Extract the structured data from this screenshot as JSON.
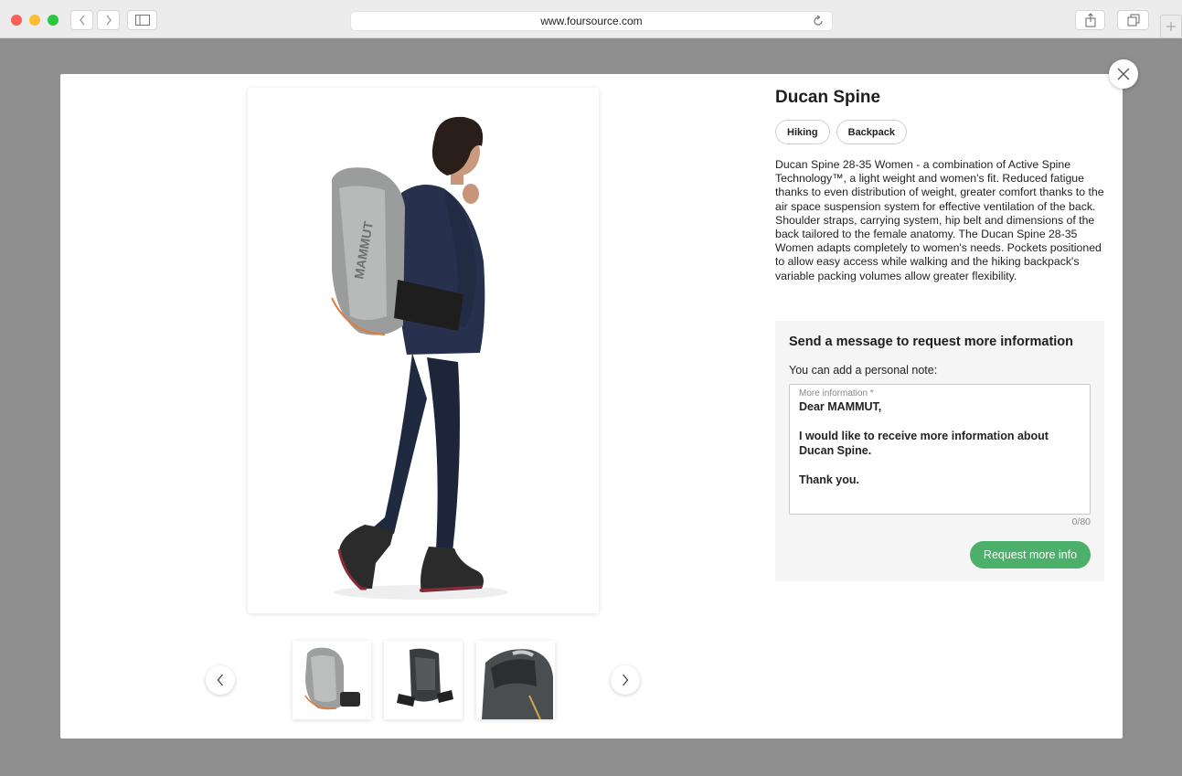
{
  "browser": {
    "url": "www.foursource.com",
    "back_icon": "chevron-left-icon",
    "forward_icon": "chevron-right-icon",
    "sidebar_icon": "sidebar-icon",
    "reload_icon": "reload-icon",
    "share_icon": "share-icon",
    "tabs_icon": "tabs-icon",
    "new_tab_icon": "plus-icon"
  },
  "product": {
    "title": "Ducan Spine",
    "tags": [
      "Hiking",
      "Backpack"
    ],
    "description": "Ducan Spine 28-35 Women - a combination of Active Spine Technology™, a light weight and women's fit. Reduced fatigue thanks to even distribution of weight, greater comfort thanks to the air space suspension system for effective ventilation of the back. Shoulder straps, carrying system, hip belt and dimensions of the back tailored to the female anatomy. The Ducan Spine 28-35 Women adapts completely to women's needs. Pockets positioned to allow easy access while walking and the hiking backpack's variable packing volumes allow greater flexibility."
  },
  "gallery": {
    "main_image": "woman-wearing-hiking-backpack",
    "thumbnails": [
      "backpack-front",
      "backpack-back",
      "backpack-top"
    ]
  },
  "message": {
    "title": "Send a message to request more information",
    "label": "You can add a personal note:",
    "field_label": "More information *",
    "field_value": "Dear MAMMUT,\n\nI would like to receive more information about Ducan Spine.\n\nThank you.",
    "counter": "0/80",
    "button_label": "Request more info"
  },
  "colors": {
    "accent": "#4caf6a",
    "overlay": "#8e8e8e"
  }
}
